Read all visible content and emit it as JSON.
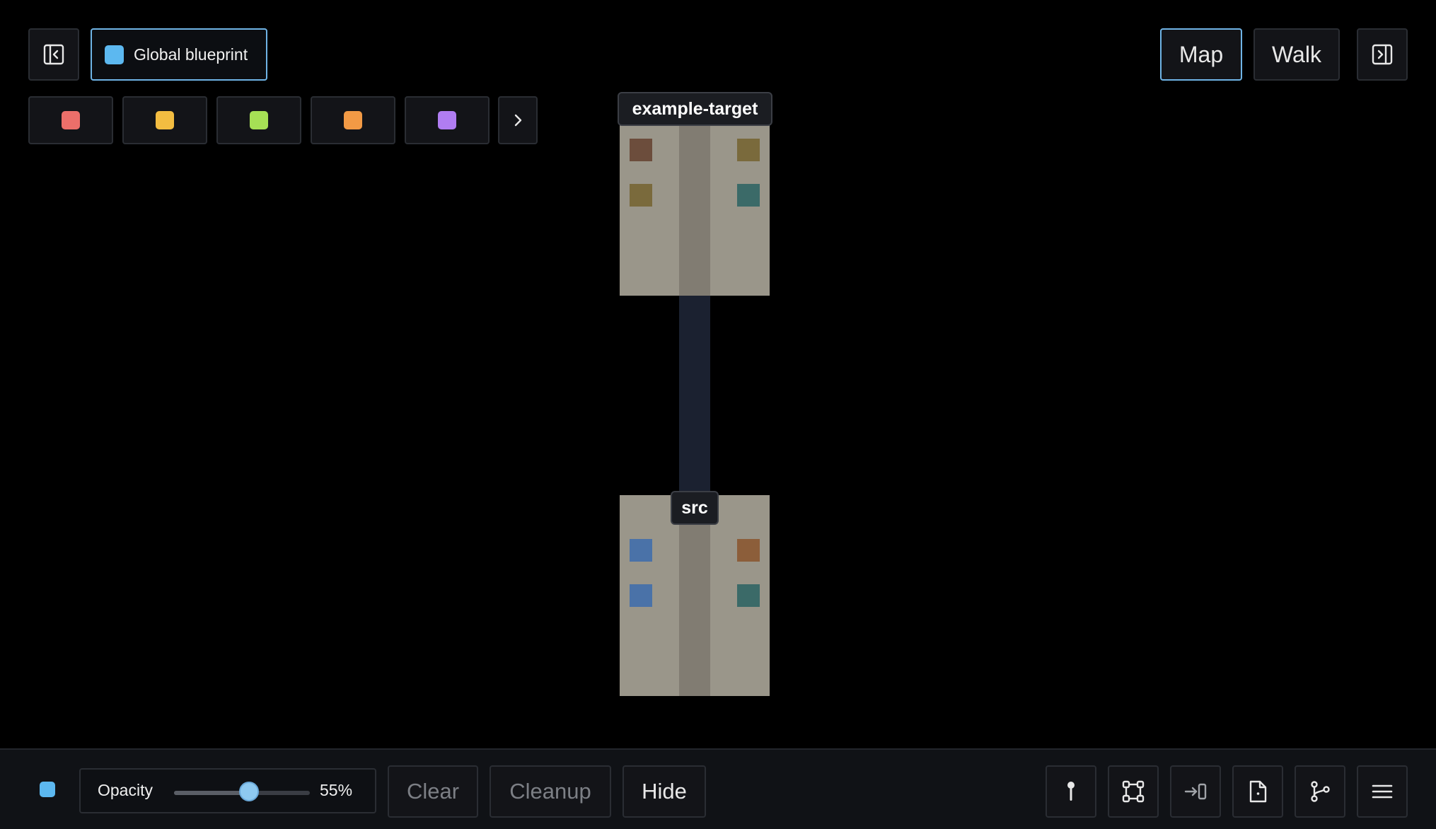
{
  "layer": {
    "label": "Global blueprint",
    "color": "#5cb8f0"
  },
  "palette": [
    {
      "name": "red",
      "color": "#ec6f6a"
    },
    {
      "name": "yellow",
      "color": "#f3bd41"
    },
    {
      "name": "green",
      "color": "#a6e055"
    },
    {
      "name": "orange",
      "color": "#f29a45"
    },
    {
      "name": "purple",
      "color": "#b07df2"
    }
  ],
  "views": {
    "map_label": "Map",
    "walk_label": "Walk",
    "active": "Map"
  },
  "buildings": {
    "top_label": "example-target",
    "bottom_label": "src",
    "top_windows": [
      "#6c4d3c",
      "#7a6a3c",
      "#7a6a3c",
      "#3b6a68"
    ],
    "bottom_windows": [
      "#4a72a8",
      "#8c5e3a",
      "#4a72a8",
      "#3b6a68"
    ]
  },
  "bottom": {
    "opacity_label": "Opacity",
    "opacity_value": "55%",
    "opacity_fraction": 0.55,
    "clear_label": "Clear",
    "cleanup_label": "Cleanup",
    "hide_label": "Hide"
  }
}
